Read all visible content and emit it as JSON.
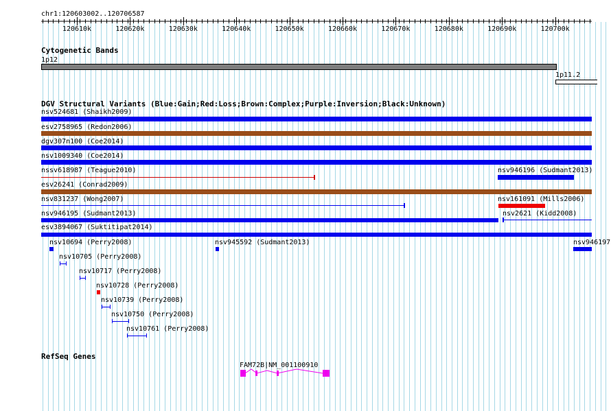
{
  "location": "chr1:120603002..120706587",
  "ruler_ticks": [
    "120610k",
    "120620k",
    "120630k",
    "120640k",
    "120650k",
    "120660k",
    "120670k",
    "120680k",
    "120690k",
    "120700k"
  ],
  "cytoband": {
    "title": "Cytogenetic Bands",
    "band_left": "1p12",
    "band_right": "1p11.2",
    "colors": {
      "gpos": "#7f7f7f",
      "gneg": "#ffffff"
    }
  },
  "dgv": {
    "title": "DGV Structural Variants (Blue:Gain;Red:Loss;Brown:Complex;Purple:Inversion;Black:Unknown)",
    "colors": {
      "gain": "#0000ee",
      "loss": "#ee0000",
      "complex": "#994d19",
      "unknown": "#000000"
    },
    "features": [
      {
        "name": "nsv524681 (Shaikh2009)",
        "type": "gain"
      },
      {
        "name": "esv2758965 (Redon2006)",
        "type": "complex"
      },
      {
        "name": "dgv307n100 (Coe2014)",
        "type": "gain"
      },
      {
        "name": "nsv1009340 (Coe2014)",
        "type": "gain"
      },
      {
        "name": "nssv618987 (Teague2010)",
        "type": "loss"
      },
      {
        "name": "nsv946196 (Sudmant2013)",
        "type": "gain"
      },
      {
        "name": "esv26241 (Conrad2009)",
        "type": "complex"
      },
      {
        "name": "nsv831237 (Wong2007)",
        "type": "gain"
      },
      {
        "name": "nsv161091 (Mills2006)",
        "type": "loss"
      },
      {
        "name": "nsv946195 (Sudmant2013)",
        "type": "gain"
      },
      {
        "name": "nsv2621 (Kidd2008)",
        "type": "gain"
      },
      {
        "name": "esv3894067 (Suktitipat2014)",
        "type": "gain"
      },
      {
        "name": "nsv10694 (Perry2008)",
        "type": "gain"
      },
      {
        "name": "nsv945592 (Sudmant2013)",
        "type": "gain"
      },
      {
        "name": "nsv946197",
        "type": "gain"
      },
      {
        "name": "nsv10705 (Perry2008)",
        "type": "gain"
      },
      {
        "name": "nsv10717 (Perry2008)",
        "type": "gain"
      },
      {
        "name": "nsv10728 (Perry2008)",
        "type": "loss"
      },
      {
        "name": "nsv10739 (Perry2008)",
        "type": "gain"
      },
      {
        "name": "nsv10750 (Perry2008)",
        "type": "gain"
      },
      {
        "name": "nsv10761 (Perry2008)",
        "type": "gain"
      }
    ]
  },
  "refseq": {
    "title": "RefSeq Genes",
    "gene_label": "FAM72B|NM_001100910",
    "color": "#ee00ee"
  }
}
